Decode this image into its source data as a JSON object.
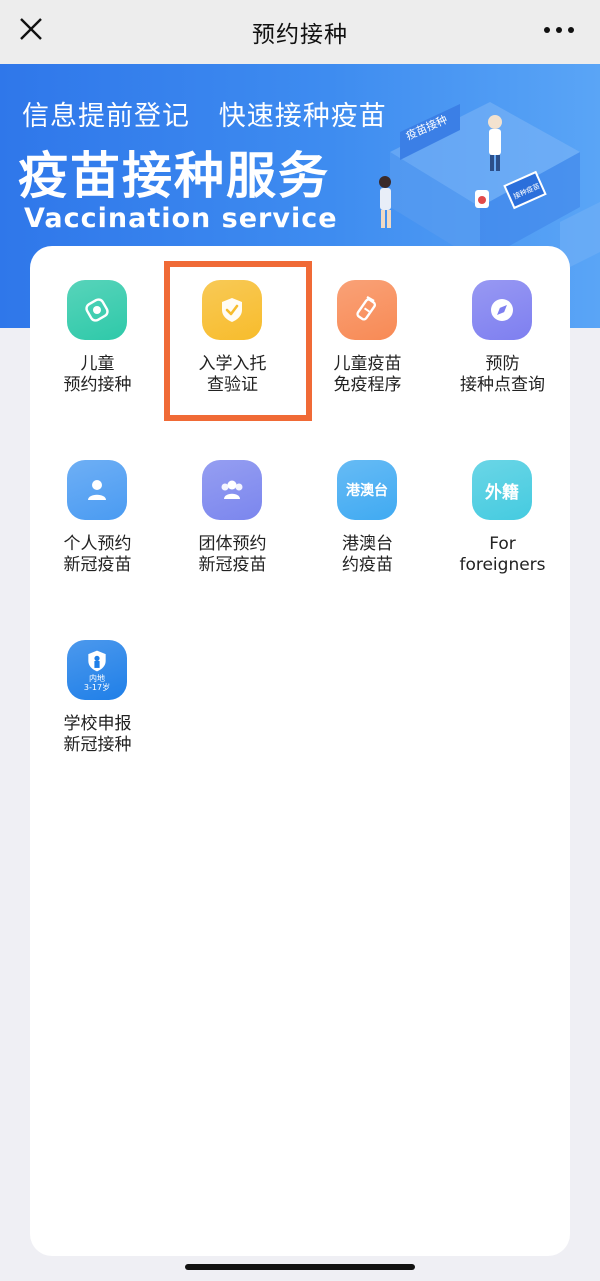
{
  "topbar": {
    "title": "预约接种",
    "close_icon": "close-icon",
    "more_icon": "more-dots-icon"
  },
  "banner": {
    "tagline": "信息提前登记   快速接种疫苗",
    "headline": "疫苗接种服务",
    "subline": "Vaccination  service",
    "illustration_sign": "疫苗接种",
    "illustration_screen": "接种疫苗"
  },
  "menu": [
    {
      "line1": "儿童",
      "line2": "预约接种",
      "icon": "child-vaccine-icon",
      "color": "#2ec9a9"
    },
    {
      "line1": "入学入托",
      "line2": "查验证",
      "icon": "shield-check-icon",
      "color": "#f7bc2c",
      "highlighted": true
    },
    {
      "line1": "儿童疫苗",
      "line2": "免疫程序",
      "icon": "syringe-icon",
      "color": "#f88a55"
    },
    {
      "line1": "预防",
      "line2": "接种点查询",
      "icon": "compass-icon",
      "color": "#7e7ff0"
    },
    {
      "line1": "个人预约",
      "line2": "新冠疫苗",
      "icon": "person-icon",
      "color": "#4a9bf2"
    },
    {
      "line1": "团体预约",
      "line2": "新冠疫苗",
      "icon": "group-icon",
      "color": "#7b86ee"
    },
    {
      "line1": "港澳台",
      "line2": "约疫苗",
      "icon": "hk-macao-taiwan-icon",
      "color": "#40aaf2",
      "icon_text": "港澳台"
    },
    {
      "line1": "For",
      "line2": "foreigners",
      "icon": "foreigner-icon",
      "color": "#45cbe0",
      "icon_text": "外籍"
    },
    {
      "line1": "学校申报",
      "line2": "新冠接种",
      "icon": "school-report-icon",
      "color": "#1f7fe8",
      "icon_text1": "内地",
      "icon_text2": "3-17岁"
    }
  ]
}
